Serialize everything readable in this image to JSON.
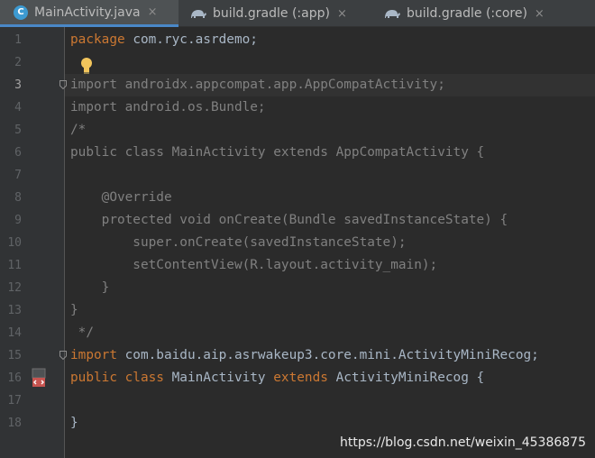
{
  "tabs": [
    {
      "label": "MainActivity.java",
      "icon": "java-class-icon",
      "active": true,
      "close": "×"
    },
    {
      "label": "build.gradle (:app)",
      "icon": "gradle-icon",
      "active": false,
      "close": "×"
    },
    {
      "label": "build.gradle (:core)",
      "icon": "gradle-icon",
      "active": false,
      "close": "×"
    }
  ],
  "line_numbers": [
    "1",
    "2",
    "3",
    "4",
    "5",
    "6",
    "7",
    "8",
    "9",
    "10",
    "11",
    "12",
    "13",
    "14",
    "15",
    "16",
    "17",
    "18"
  ],
  "current_line": "3",
  "code": {
    "l1_kw": "package",
    "l1_rest": " com.ryc.asrdemo;",
    "l3": "import androidx.appcompat.app.AppCompatActivity;",
    "l4": "import android.os.Bundle;",
    "l5": "/*",
    "l6": "public class MainActivity extends AppCompatActivity {",
    "l8": "    @Override",
    "l9": "    protected void onCreate(Bundle savedInstanceState) {",
    "l10": "        super.onCreate(savedInstanceState);",
    "l11": "        setContentView(R.layout.activity_main);",
    "l12": "    }",
    "l13": "}",
    "l14": " */",
    "l15_kw": "import",
    "l15_rest": " com.baidu.aip.asrwakeup3.core.mini.ActivityMiniRecog;",
    "l16_kw1": "public class",
    "l16_mid": " MainActivity ",
    "l16_kw2": "extends",
    "l16_rest": " ActivityMiniRecog {",
    "l18": "}"
  },
  "watermark": "https://blog.csdn.net/weixin_45386875",
  "colors": {
    "background": "#2b2b2b",
    "keyword": "#cc7832",
    "comment": "#808080",
    "text": "#a9b7c6",
    "tab_underline": "#4a88c7"
  }
}
